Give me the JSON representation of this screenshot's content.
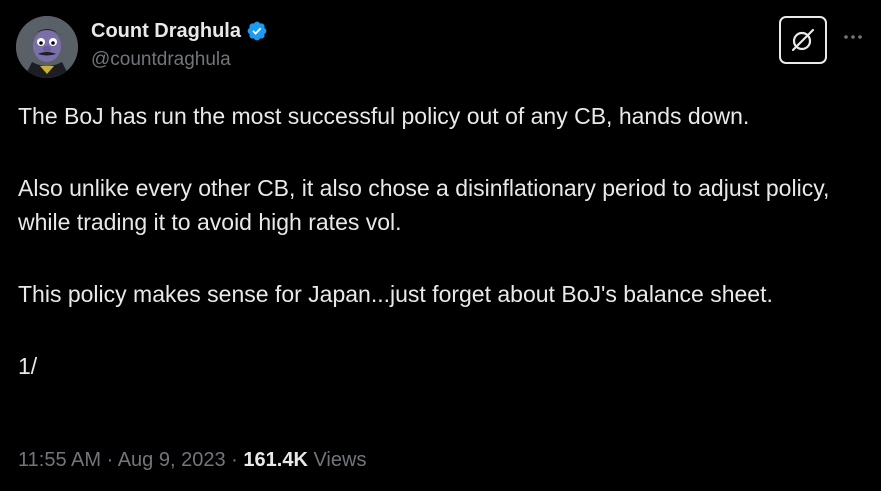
{
  "author": {
    "display_name": "Count Draghula",
    "handle": "@countdraghula",
    "verified_color": "#1d9bf0"
  },
  "icons": {
    "verified": "verified-badge-icon",
    "grok": "grok-icon",
    "more": "more-options-icon"
  },
  "tweet": {
    "paragraphs": [
      "The BoJ has run the most successful policy out of any CB, hands down.",
      "Also unlike every other CB, it also chose a disinflationary period to adjust policy, while trading it to avoid high rates vol.",
      "This policy makes sense for Japan...just forget about BoJ's balance sheet.",
      "1/"
    ]
  },
  "meta": {
    "time": "11:55 AM",
    "separator": "·",
    "date": "Aug 9, 2023",
    "views_count": "161.4K",
    "views_label": "Views"
  },
  "colors": {
    "background": "#000000",
    "text": "#e7e9ea",
    "muted": "#71767b"
  }
}
